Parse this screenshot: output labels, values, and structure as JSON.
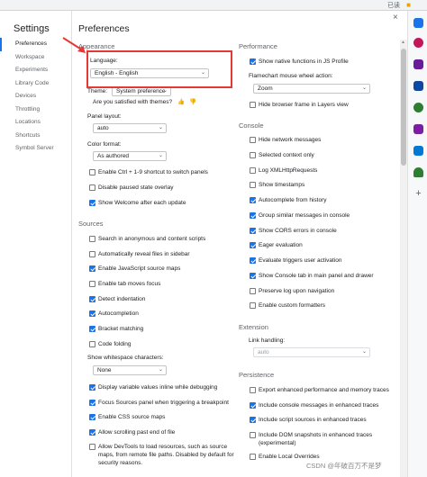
{
  "topbar": {
    "right_text": "已读"
  },
  "sidebar": {
    "title": "Settings",
    "items": [
      {
        "label": "Preferences",
        "active": true
      },
      {
        "label": "Workspace"
      },
      {
        "label": "Experiments"
      },
      {
        "label": "Library Code"
      },
      {
        "label": "Devices"
      },
      {
        "label": "Throttling"
      },
      {
        "label": "Locations"
      },
      {
        "label": "Shortcuts"
      },
      {
        "label": "Symbol Server"
      }
    ]
  },
  "main": {
    "title": "Preferences",
    "close_glyph": "×",
    "appearance": {
      "title": "Appearance",
      "language_label": "Language:",
      "language_value": "English - English",
      "theme_label": "Theme:",
      "theme_value": "System preference",
      "satisfied": "Are you satisfied with themes?",
      "panel_layout_label": "Panel layout:",
      "panel_layout_value": "auto",
      "color_format_label": "Color format:",
      "color_format_value": "As authored",
      "options": [
        {
          "label": "Enable Ctrl + 1-9 shortcut to switch panels",
          "checked": false
        },
        {
          "label": "Disable paused state overlay",
          "checked": false
        },
        {
          "label": "Show Welcome after each update",
          "checked": true
        }
      ]
    },
    "sources": {
      "title": "Sources",
      "options": [
        {
          "label": "Search in anonymous and content scripts",
          "checked": false
        },
        {
          "label": "Automatically reveal files in sidebar",
          "checked": false
        },
        {
          "label": "Enable JavaScript source maps",
          "checked": true
        },
        {
          "label": "Enable tab moves focus",
          "checked": false
        },
        {
          "label": "Detect indentation",
          "checked": true
        },
        {
          "label": "Autocompletion",
          "checked": true
        },
        {
          "label": "Bracket matching",
          "checked": true
        },
        {
          "label": "Code folding",
          "checked": false
        }
      ],
      "whitespace_label": "Show whitespace characters:",
      "whitespace_value": "None",
      "options2": [
        {
          "label": "Display variable values inline while debugging",
          "checked": true
        },
        {
          "label": "Focus Sources panel when triggering a breakpoint",
          "checked": true
        },
        {
          "label": "Enable CSS source maps",
          "checked": true
        },
        {
          "label": "Allow scrolling past end of file",
          "checked": true
        },
        {
          "label": "Allow DevTools to load resources, such as source maps, from remote file paths. Disabled by default for security reasons.",
          "checked": false
        }
      ]
    },
    "performance": {
      "title": "Performance",
      "options": [
        {
          "label": "Show native functions in JS Profile",
          "checked": true
        }
      ],
      "flamechart_label": "Flamechart mouse wheel action:",
      "flamechart_value": "Zoom",
      "options2": [
        {
          "label": "Hide browser frame in Layers view",
          "checked": false
        }
      ]
    },
    "console": {
      "title": "Console",
      "options": [
        {
          "label": "Hide network messages",
          "checked": false
        },
        {
          "label": "Selected context only",
          "checked": false
        },
        {
          "label": "Log XMLHttpRequests",
          "checked": false
        },
        {
          "label": "Show timestamps",
          "checked": false
        },
        {
          "label": "Autocomplete from history",
          "checked": true
        },
        {
          "label": "Group similar messages in console",
          "checked": true
        },
        {
          "label": "Show CORS errors in console",
          "checked": true
        },
        {
          "label": "Eager evaluation",
          "checked": true
        },
        {
          "label": "Evaluate triggers user activation",
          "checked": true
        },
        {
          "label": "Show Console tab in main panel and drawer",
          "checked": true
        },
        {
          "label": "Preserve log upon navigation",
          "checked": false
        },
        {
          "label": "Enable custom formatters",
          "checked": false
        }
      ]
    },
    "extension": {
      "title": "Extension",
      "link_label": "Link handling:",
      "link_value": "auto"
    },
    "persistence": {
      "title": "Persistence",
      "options": [
        {
          "label": "Export enhanced performance and memory traces",
          "checked": false
        },
        {
          "label": "Include console messages in enhanced traces",
          "checked": true
        },
        {
          "label": "Include script sources in enhanced traces",
          "checked": true
        },
        {
          "label": "Include DOM snapshots in enhanced traces (experimental)",
          "checked": false
        },
        {
          "label": "Enable Local Overrides",
          "checked": false
        }
      ]
    }
  },
  "watermark": "CSDN @年破百万不是梦",
  "rightbar_icons": [
    {
      "name": "search-icon",
      "color": "#1a73e8"
    },
    {
      "name": "person-icon",
      "color": "#c2185b"
    },
    {
      "name": "bag-icon",
      "color": "#6a1b9a"
    },
    {
      "name": "tag-icon",
      "color": "#0d47a1"
    },
    {
      "name": "ai-icon",
      "color": "#2e7d32"
    },
    {
      "name": "puzzle-icon",
      "color": "#7b1fa2"
    },
    {
      "name": "outlook-icon",
      "color": "#0078d4"
    },
    {
      "name": "tree-icon",
      "color": "#2e7d32"
    },
    {
      "name": "plus-icon",
      "color": "#5f6368"
    }
  ]
}
